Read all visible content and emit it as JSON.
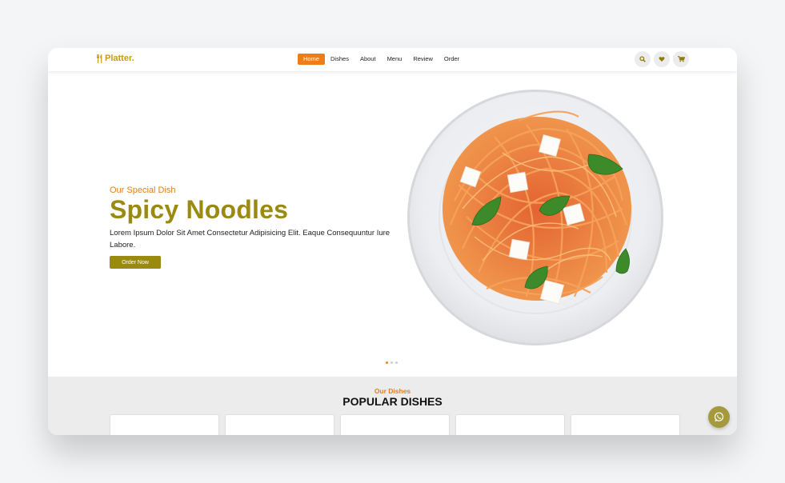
{
  "brand": {
    "name": "Platter."
  },
  "nav": {
    "items": [
      {
        "label": "Home",
        "active": true
      },
      {
        "label": "Dishes"
      },
      {
        "label": "About"
      },
      {
        "label": "Menu"
      },
      {
        "label": "Review"
      },
      {
        "label": "Order"
      }
    ],
    "icons": [
      "search-icon",
      "heart-icon",
      "cart-icon"
    ]
  },
  "hero": {
    "subtitle": "Our Special Dish",
    "title": "Spicy Noodles",
    "description": "Lorem Ipsum Dolor Sit Amet Consectetur Adipisicing Elit. Eaque Consequuntur Iure Labore.",
    "button": "Order Now",
    "slide_count": 3,
    "active_slide": 1
  },
  "popular": {
    "subtitle": "Our Dishes",
    "title": "POPULAR DISHES",
    "card_count": 5
  },
  "colors": {
    "accent": "#ef7d17",
    "olive": "#9b8a10",
    "whatsapp": "#a49a3c"
  }
}
